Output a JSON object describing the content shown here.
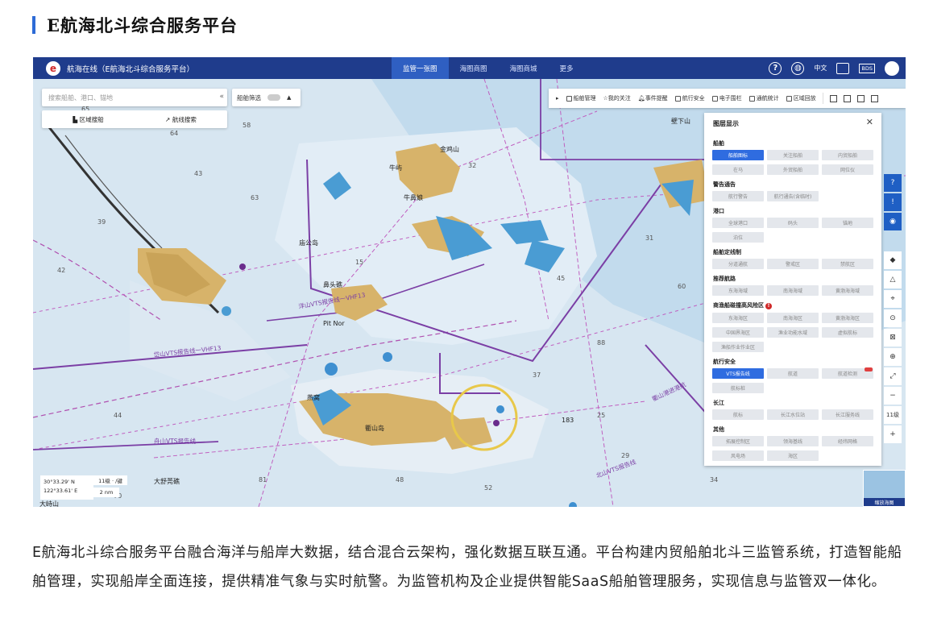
{
  "heading": "E航海北斗综合服务平台",
  "app": {
    "logo_letter": "e",
    "name": "航海在线（E航海北斗综合服务平台）"
  },
  "nav": {
    "tabs": [
      "监管一张图",
      "海图商图",
      "海图商城",
      "更多"
    ],
    "active_tab": "监管一张图",
    "language": "中文",
    "bds": "BDS"
  },
  "search": {
    "placeholder": "搜索船舶、港口、锚地",
    "collapse": "«",
    "region_button": "区域搜船",
    "track_button": "航线搜索"
  },
  "filter": {
    "label": "船舶筛选",
    "arrow": "▲"
  },
  "toolbar": {
    "items": [
      "船舶管理",
      "我的关注",
      "事件提醒",
      "航行安全",
      "电子围栏",
      "通航统计",
      "区域回放"
    ]
  },
  "layer_panel": {
    "title": "图层显示",
    "close": "✕",
    "sections": {
      "ship": "船舶",
      "warning": "警告通告",
      "port": "港口",
      "route_control": "船舶定线制",
      "recommended": "推荐航路",
      "fishing_risk": "商渔船碰撞高风险区",
      "nav_safety": "航行安全",
      "yangtze": "长江",
      "other": "其他"
    },
    "warning_badge": "!",
    "buttons": {
      "ship": [
        "船舶图标",
        "关注船舶",
        "内贸船舶",
        "在马",
        "外贸船舶",
        "网位仪"
      ],
      "warning": [
        "航行警告",
        "航行通告(含临时)"
      ],
      "port": [
        "全球港口",
        "码头",
        "锚地",
        "泊位"
      ],
      "route_control": [
        "分道通航",
        "警戒区",
        "禁航区"
      ],
      "recommended": [
        "东海海域",
        "南海海域",
        "黄渤海海域"
      ],
      "fishing_risk": [
        "东海海区",
        "南海海区",
        "黄渤海海区",
        "中国界海区",
        "渔业功能水域",
        "虚拟航标",
        "渔船作业作业区"
      ],
      "nav_safety": [
        "VTS报告线",
        "航道",
        "航道检测",
        "航标桩"
      ],
      "yangtze": [
        "航标",
        "长江水位站",
        "长江服务线"
      ],
      "other": [
        "拓展控制区",
        "领海基线",
        "经纬网格",
        "风电场",
        "海区"
      ]
    },
    "active_buttons": [
      "船舶图标",
      "VTS报告线"
    ]
  },
  "right_tools": {
    "zoom_in": "+",
    "zoom_out": "−",
    "level": "11级"
  },
  "status": {
    "lat": "30°33.29' N",
    "lon": "122°33.61' E",
    "level": "11级 · /键",
    "scale": "2 nm"
  },
  "minimap": {
    "caption": "缩放海图"
  },
  "map_labels": {
    "island_1": "牛屿",
    "island_2": "牛鼻娘",
    "island_3": "金鸡山",
    "island_4": "鼻头礁",
    "island_5": "庙公岛",
    "island_6": "衢山岛",
    "island_7": "燕窝",
    "island_8": "大舒莞礁",
    "island_9": "大峙山",
    "island_10": "壁下山",
    "point_1": "Pit Nor",
    "line_1": "洋山VTS报告线一VHF13",
    "line_2": "岱山VTS报告线一VHF13",
    "line_3": "舟山VTS报告线",
    "line_4": "衢山港进港航",
    "line_5": "北山VTS报告线",
    "depth_1": "183"
  },
  "description": "E航海北斗综合服务平台融合海洋与船岸大数据，结合混合云架构，强化数据互联互通。平台构建内贸船舶北斗三监管系统，打造智能船舶管理，实现船岸全面连接，提供精准气象与实时航警。为监管机构及企业提供智能SaaS船舶管理服务，实现信息与监管双一体化。"
}
